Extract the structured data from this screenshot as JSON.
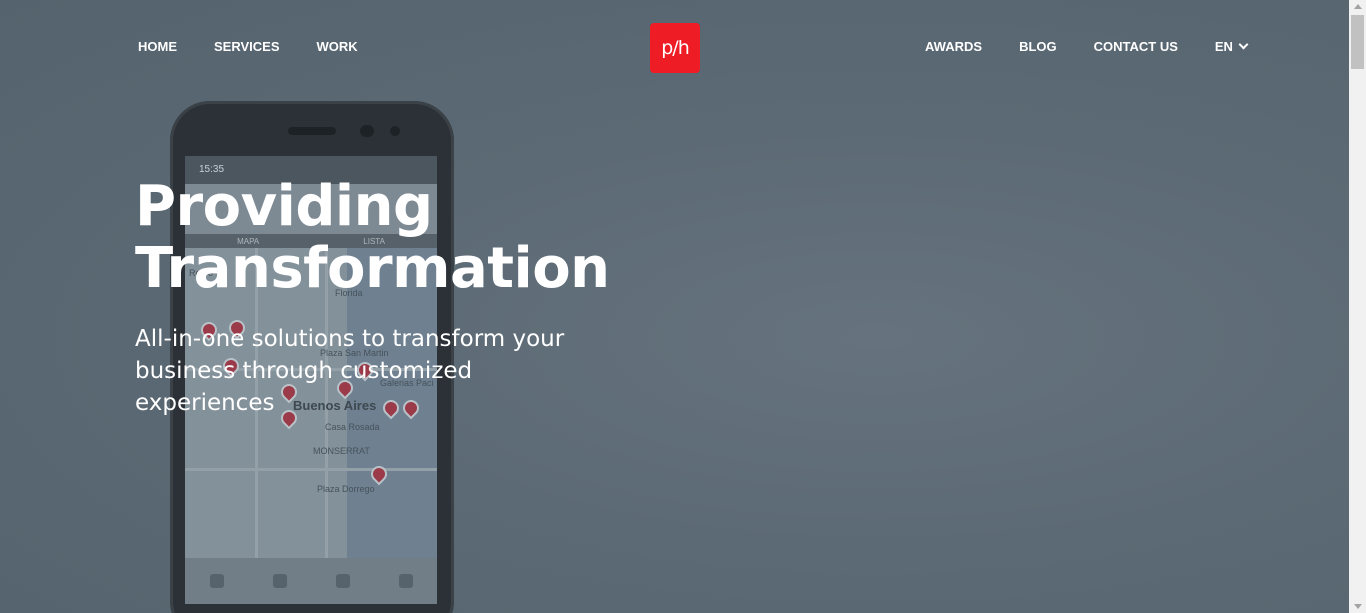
{
  "nav": {
    "left": [
      {
        "label": "HOME"
      },
      {
        "label": "SERVICES"
      },
      {
        "label": "WORK"
      }
    ],
    "right": [
      {
        "label": "AWARDS"
      },
      {
        "label": "BLOG"
      },
      {
        "label": "CONTACT US"
      }
    ],
    "language": {
      "label": "EN",
      "icon": "chevron-down-icon"
    }
  },
  "logo": {
    "text": "p/h",
    "color": "#ee1c24"
  },
  "hero": {
    "headline_line1": "Providing",
    "headline_line2": "Transformation",
    "subline": "All-in-one solutions to transform your business through customized experiences"
  },
  "phone_mockup": {
    "status_time": "15:35",
    "tabs": [
      "MAPA",
      "LISTA"
    ],
    "map_labels": [
      "Buenos Aires",
      "Casa Rosada",
      "MONSERRAT",
      "Plaza San Martin",
      "Galerias Paci",
      "Plaza Dorrego",
      "Retiro",
      "Florida"
    ]
  },
  "colors": {
    "overlay": "#5f6d78",
    "text": "#ffffff",
    "pin": "#9b3b4a"
  }
}
